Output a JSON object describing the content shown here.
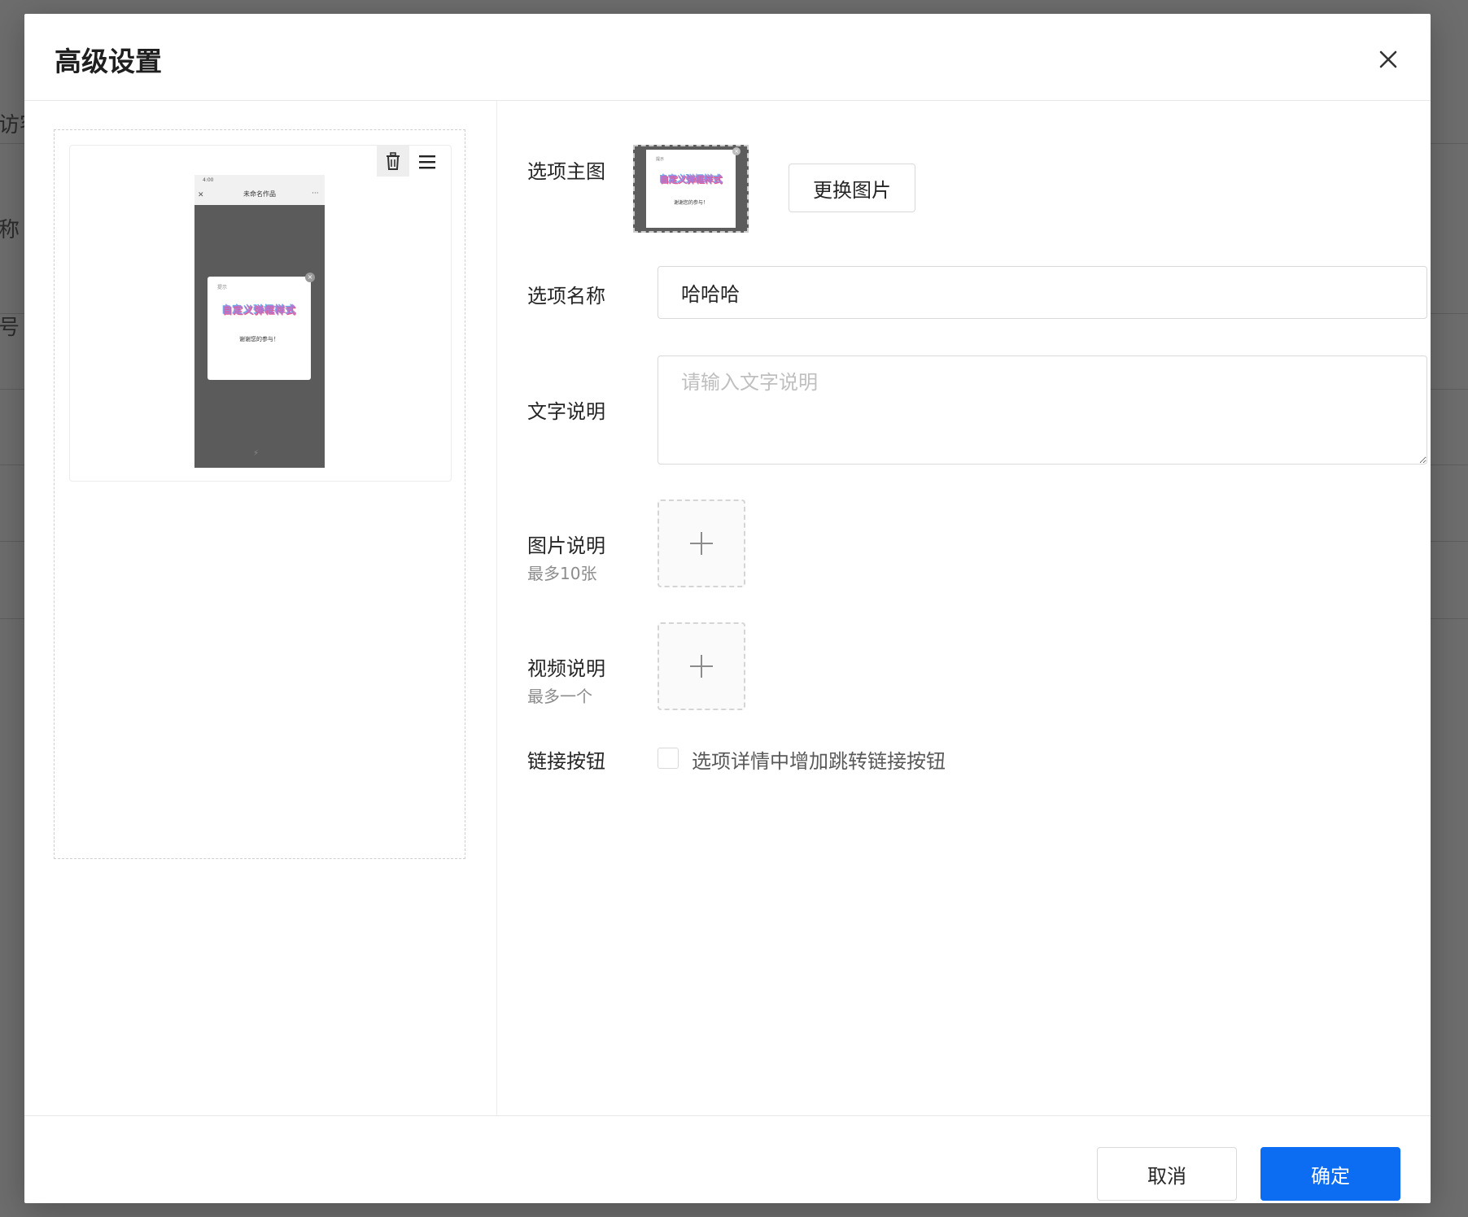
{
  "background": {
    "labels": [
      "访客",
      "称",
      "号"
    ]
  },
  "modal": {
    "title": "高级设置"
  },
  "preview": {
    "phone": {
      "status_bar": "4:00",
      "title": "未命名作品",
      "popup_small_label": "提示",
      "popup_fancy_text": "自定义弹框样式",
      "popup_thanks_text": "谢谢您的参与！",
      "footer_mark": "⚡"
    }
  },
  "form": {
    "main_image_label": "选项主图",
    "replace_button_label": "更换图片",
    "name_label": "选项名称",
    "name_value": "哈哈哈",
    "text_label": "文字说明",
    "text_placeholder": "请输入文字说明",
    "image_label": "图片说明",
    "image_sublabel": "最多10张",
    "video_label": "视频说明",
    "video_sublabel": "最多一个",
    "link_label": "链接按钮",
    "link_checkbox_label": "选项详情中增加跳转链接按钮"
  },
  "footer": {
    "cancel_label": "取消",
    "ok_label": "确定"
  },
  "colors": {
    "primary": "#0c6cf2",
    "overlay": "#6d6d6d"
  }
}
